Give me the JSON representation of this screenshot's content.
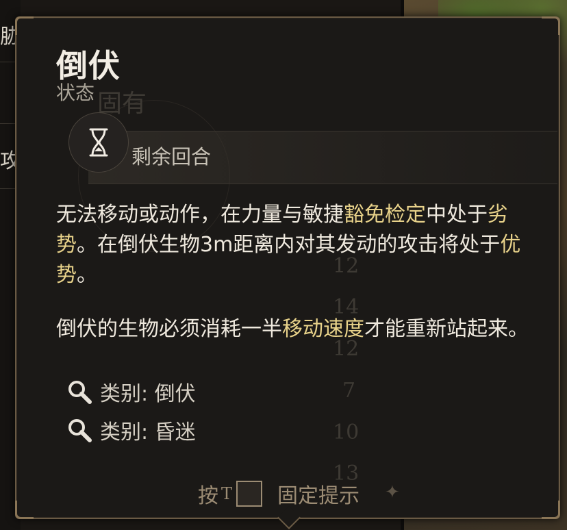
{
  "background": {
    "left_labels": [
      "胁",
      "攻"
    ]
  },
  "tooltip": {
    "title": "倒伏",
    "subtitle": "状态",
    "duration_label": "剩余回合",
    "description": {
      "p1": [
        {
          "text": "无法移动或动作，在力量与敏捷",
          "kw": false
        },
        {
          "text": "豁免检定",
          "kw": true
        },
        {
          "text": "中处于",
          "kw": false
        },
        {
          "text": "劣势",
          "kw": true
        },
        {
          "text": "。在倒伏生物3m距离内对其发动的攻击将处于",
          "kw": false
        },
        {
          "text": "优势",
          "kw": true
        },
        {
          "text": "。",
          "kw": false
        }
      ],
      "p2": [
        {
          "text": "倒伏的生物必须消耗一半",
          "kw": false
        },
        {
          "text": "移动速度",
          "kw": true
        },
        {
          "text": "才能重新站起来。",
          "kw": false
        }
      ]
    },
    "categories": [
      {
        "label": "类别: 倒伏",
        "icon": "magnifier-icon"
      },
      {
        "label": "类别: 昏迷",
        "icon": "magnifier-icon"
      }
    ],
    "footer": {
      "press": "按",
      "key": "T",
      "action": "固定提示"
    },
    "watermark": {
      "text": "固有",
      "numbers": [
        "12",
        "14",
        "12",
        "7",
        "10",
        "13"
      ]
    }
  },
  "colors": {
    "keyword": "#e8d28a",
    "text": "#efe9de",
    "border": "#6a5a44"
  }
}
